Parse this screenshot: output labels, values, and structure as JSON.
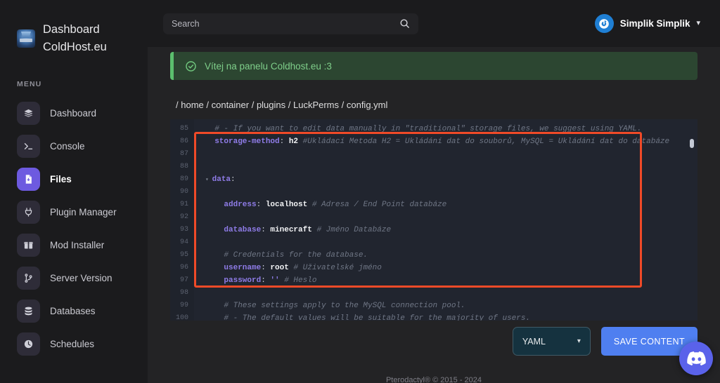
{
  "sidebar": {
    "brand": {
      "line1": "Dashboard",
      "line2": "ColdHost.eu",
      "logo_icon": "coldhost-logo-icon"
    },
    "menu_label": "MENU",
    "items": [
      {
        "label": "Dashboard",
        "icon": "layers-icon",
        "active": false
      },
      {
        "label": "Console",
        "icon": "terminal-icon",
        "active": false
      },
      {
        "label": "Files",
        "icon": "file-icon",
        "active": true
      },
      {
        "label": "Plugin Manager",
        "icon": "plug-icon",
        "active": false
      },
      {
        "label": "Mod Installer",
        "icon": "box-icon",
        "active": false
      },
      {
        "label": "Server Version",
        "icon": "git-branch-icon",
        "active": false
      },
      {
        "label": "Databases",
        "icon": "database-icon",
        "active": false
      },
      {
        "label": "Schedules",
        "icon": "clock-icon",
        "active": false
      }
    ]
  },
  "topbar": {
    "search": {
      "value": "",
      "placeholder": "Search",
      "icon": "search-icon"
    },
    "user": {
      "name": "Simplik Simplik",
      "avatar_icon": "user-avatar-icon",
      "caret": "⌄"
    }
  },
  "alert": {
    "icon": "check-circle-icon",
    "text": "Vítej na panelu Coldhost.eu :3",
    "accent_color": "#5bbf6d",
    "bg_color": "#2c4631"
  },
  "breadcrumb": {
    "full": "/ home / container / plugins / LuckPerms / config.yml",
    "parts": [
      "/ ",
      "home",
      " / ",
      "container",
      " / ",
      "plugins",
      " / ",
      "LuckPerms",
      " / ",
      "config.yml"
    ]
  },
  "editor": {
    "language": "YAML",
    "highlight_color": "#f04a28",
    "first_line": 85,
    "lines": [
      {
        "n": 85,
        "segments": [
          {
            "t": "  # - If you want to edit data manually in \"traditional\" storage files, we suggest using YAML.",
            "c": "c"
          }
        ]
      },
      {
        "n": 86,
        "segments": [
          {
            "t": "  ",
            "c": "p"
          },
          {
            "t": "storage-method",
            "c": "k"
          },
          {
            "t": ": ",
            "c": "p"
          },
          {
            "t": "h2",
            "c": "v"
          },
          {
            "t": " #Ukládací Metoda H2 = Ukládání dat do souborů, MySQL = Ukládání dat do databáze",
            "c": "c"
          }
        ]
      },
      {
        "n": 87,
        "segments": []
      },
      {
        "n": 88,
        "segments": []
      },
      {
        "n": 89,
        "segments": [
          {
            "t": "▾ ",
            "c": "fold"
          },
          {
            "t": "data",
            "c": "k"
          },
          {
            "t": ":",
            "c": "p"
          }
        ]
      },
      {
        "n": 90,
        "segments": []
      },
      {
        "n": 91,
        "segments": [
          {
            "t": "    ",
            "c": "p"
          },
          {
            "t": "address",
            "c": "k"
          },
          {
            "t": ": ",
            "c": "p"
          },
          {
            "t": "localhost",
            "c": "v"
          },
          {
            "t": " # Adresa / End Point databáze",
            "c": "c"
          }
        ]
      },
      {
        "n": 92,
        "segments": []
      },
      {
        "n": 93,
        "segments": [
          {
            "t": "    ",
            "c": "p"
          },
          {
            "t": "database",
            "c": "k"
          },
          {
            "t": ": ",
            "c": "p"
          },
          {
            "t": "minecraft",
            "c": "v"
          },
          {
            "t": " # Jméno Databáze",
            "c": "c"
          }
        ]
      },
      {
        "n": 94,
        "segments": []
      },
      {
        "n": 95,
        "segments": [
          {
            "t": "    # Credentials for the database.",
            "c": "c"
          }
        ]
      },
      {
        "n": 96,
        "segments": [
          {
            "t": "    ",
            "c": "p"
          },
          {
            "t": "username",
            "c": "k"
          },
          {
            "t": ": ",
            "c": "p"
          },
          {
            "t": "root",
            "c": "v"
          },
          {
            "t": " # Uživatelské jméno",
            "c": "c"
          }
        ]
      },
      {
        "n": 97,
        "segments": [
          {
            "t": "    ",
            "c": "p"
          },
          {
            "t": "password",
            "c": "k"
          },
          {
            "t": ": ",
            "c": "p"
          },
          {
            "t": "''",
            "c": "k"
          },
          {
            "t": " # Heslo",
            "c": "c"
          }
        ]
      },
      {
        "n": 98,
        "segments": []
      },
      {
        "n": 99,
        "segments": [
          {
            "t": "    # These settings apply to the MySQL connection pool.",
            "c": "c"
          }
        ]
      },
      {
        "n": 100,
        "segments": [
          {
            "t": "    # - The default values will be suitable for the majority of users.",
            "c": "c"
          }
        ]
      }
    ]
  },
  "bottom": {
    "language_select": {
      "value": "YAML",
      "caret": "⌄"
    },
    "save_button": "SAVE CONTENT",
    "discord_button": {
      "icon": "discord-icon",
      "color": "#5a62ea"
    }
  },
  "footer": {
    "text": "Pterodactyl® © 2015 - 2024"
  }
}
